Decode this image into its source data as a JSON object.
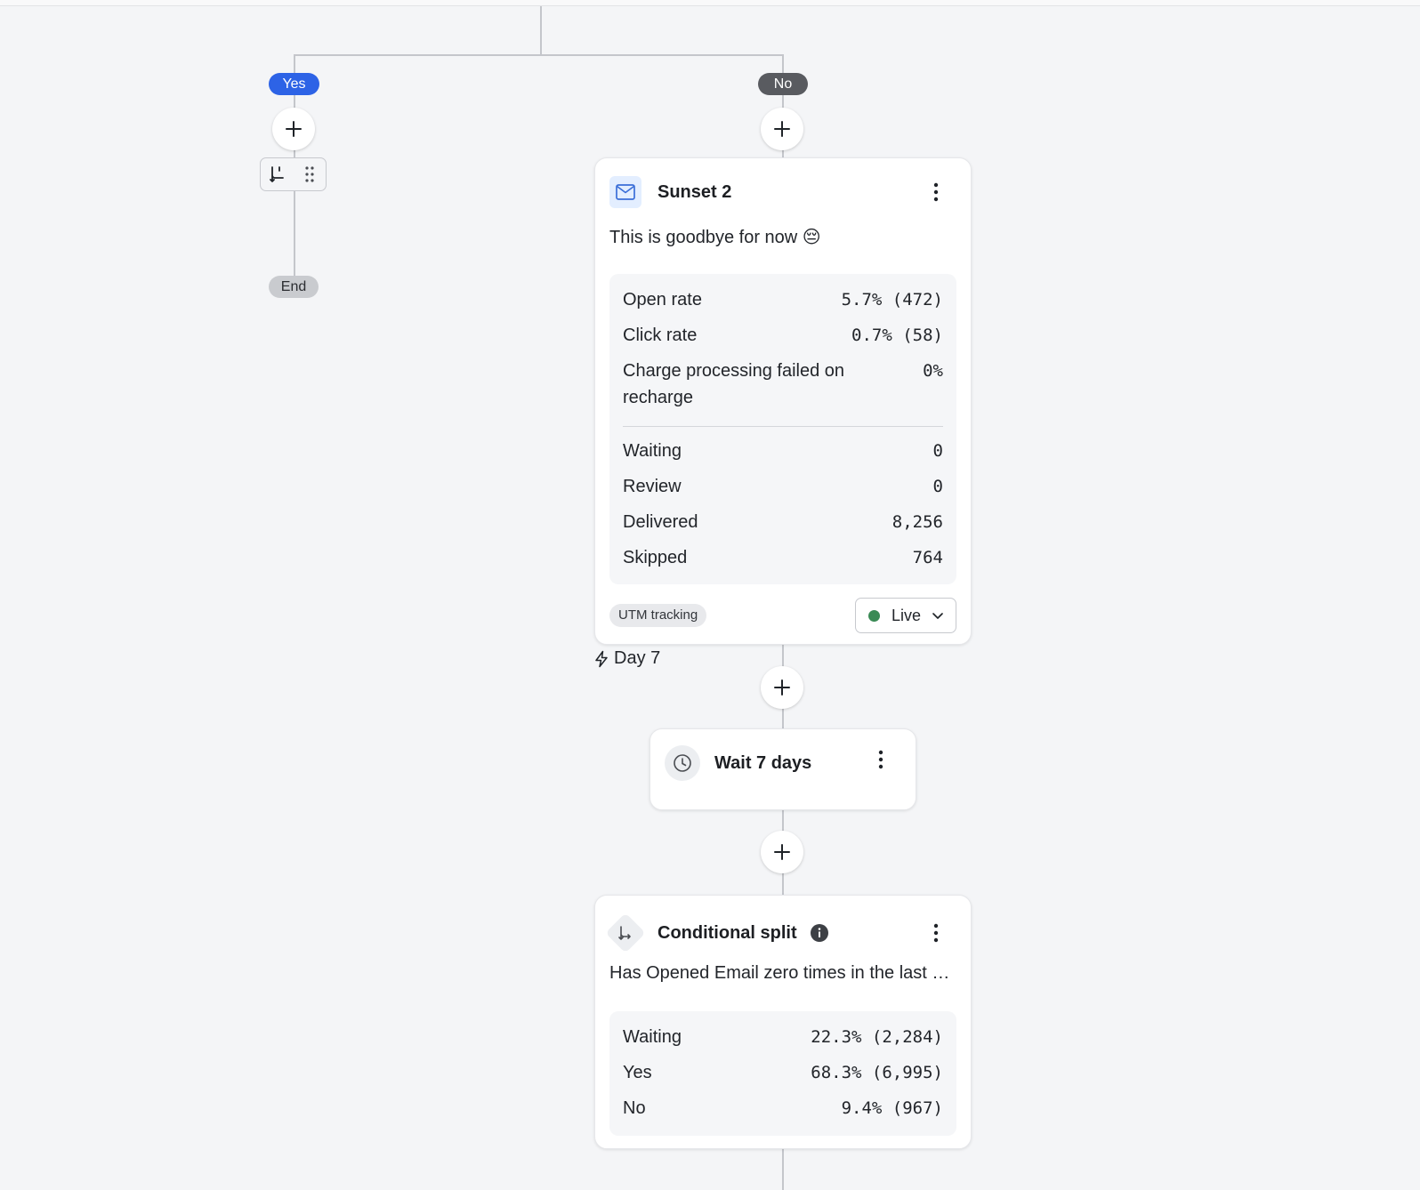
{
  "branch": {
    "yes_label": "Yes",
    "no_label": "No",
    "end_label": "End"
  },
  "icons": {
    "plus": "plus-icon",
    "split_branch": "split-branch-icon",
    "drag_handle": "drag-handle-icon",
    "email": "mail-icon",
    "clock": "clock-icon",
    "split": "conditional-split-icon",
    "info": "info-icon",
    "more": "more-vertical-icon",
    "lightning": "lightning-icon",
    "chevron": "chevron-down-icon"
  },
  "email_card": {
    "title": "Sunset 2",
    "subject": "This is goodbye for now 😔",
    "metrics": [
      {
        "label": "Open rate",
        "value": "5.7% (472)"
      },
      {
        "label": "Click rate",
        "value": "0.7% (58)"
      },
      {
        "label": "Charge processing failed on recharge",
        "value": "0%"
      }
    ],
    "counts": [
      {
        "label": "Waiting",
        "value": "0"
      },
      {
        "label": "Review",
        "value": "0"
      },
      {
        "label": "Delivered",
        "value": "8,256"
      },
      {
        "label": "Skipped",
        "value": "764"
      }
    ],
    "tag": "UTM tracking",
    "status": "Live",
    "status_color": "#3a8a55"
  },
  "trigger_day": "Day 7",
  "wait_card": {
    "title": "Wait 7 days"
  },
  "split_card": {
    "title": "Conditional split",
    "condition": "Has Opened Email zero times in the last 7...",
    "rows": [
      {
        "label": "Waiting",
        "value": "22.3% (2,284)"
      },
      {
        "label": "Yes",
        "value": "68.3% (6,995)"
      },
      {
        "label": "No",
        "value": "9.4% (967)"
      }
    ]
  },
  "colors": {
    "yes_pill": "#2d63e6",
    "no_pill": "#595b60",
    "canvas": "#f4f5f7"
  }
}
